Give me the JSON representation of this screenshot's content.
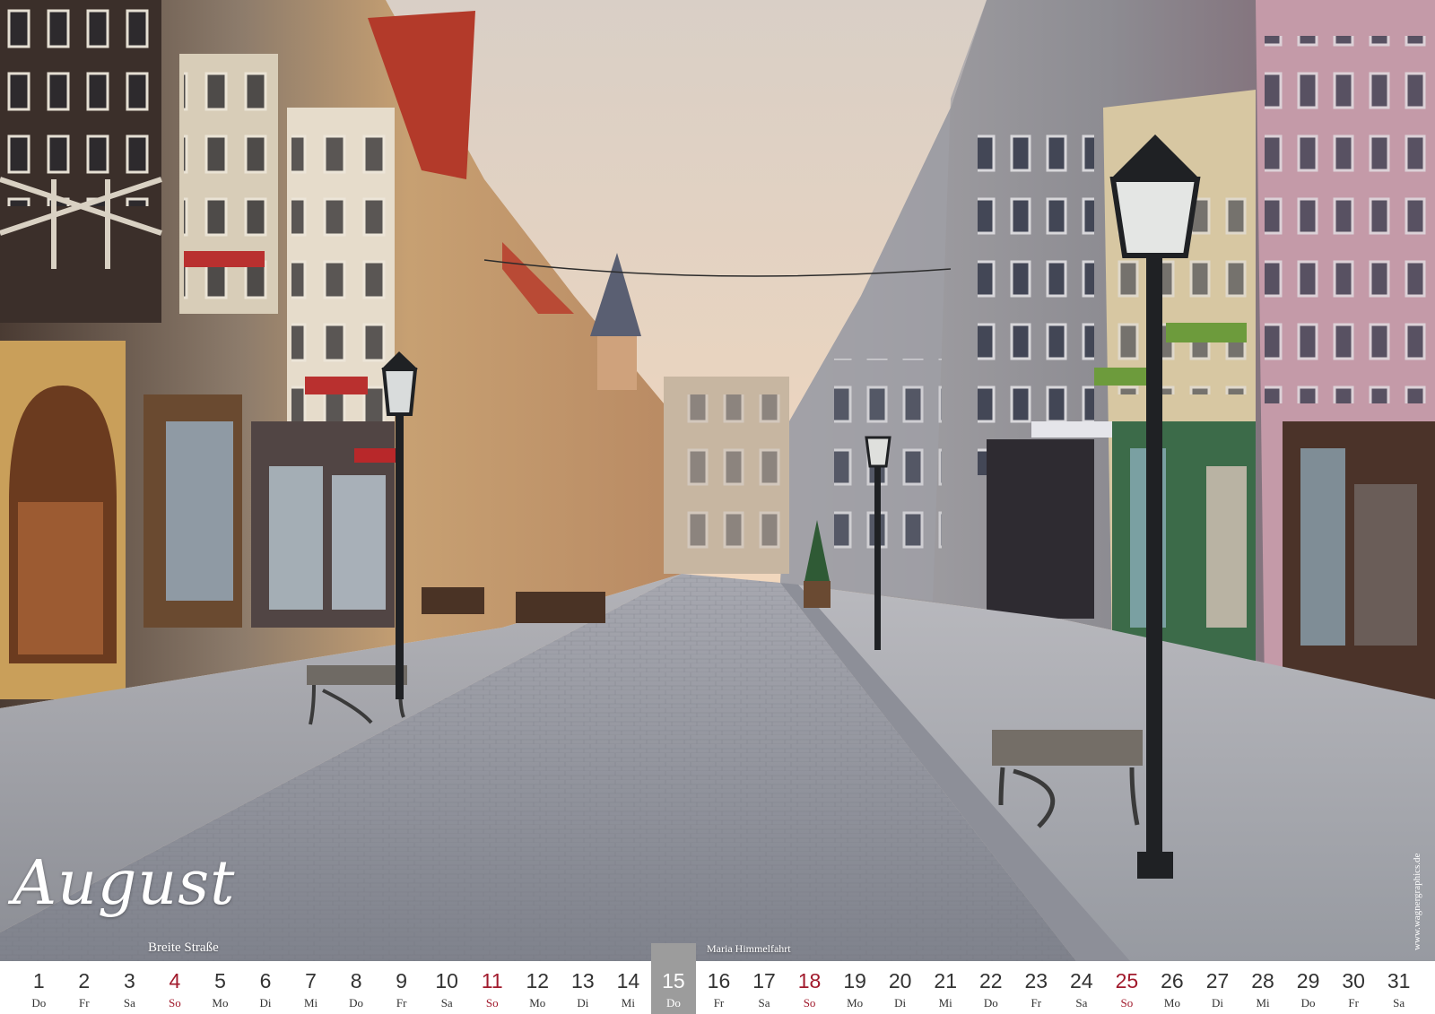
{
  "month": "August",
  "place": "Breite Straße",
  "holiday": "Maria Himmelfahrt",
  "website": "www.wagnergraphics.de",
  "colors": {
    "sunday": "#a11a2c",
    "today_bg": "#9c9c9c",
    "text": "#333333"
  },
  "today": 15,
  "days": [
    {
      "n": "1",
      "wd": "Do"
    },
    {
      "n": "2",
      "wd": "Fr"
    },
    {
      "n": "3",
      "wd": "Sa"
    },
    {
      "n": "4",
      "wd": "So"
    },
    {
      "n": "5",
      "wd": "Mo"
    },
    {
      "n": "6",
      "wd": "Di"
    },
    {
      "n": "7",
      "wd": "Mi"
    },
    {
      "n": "8",
      "wd": "Do"
    },
    {
      "n": "9",
      "wd": "Fr"
    },
    {
      "n": "10",
      "wd": "Sa"
    },
    {
      "n": "11",
      "wd": "So"
    },
    {
      "n": "12",
      "wd": "Mo"
    },
    {
      "n": "13",
      "wd": "Di"
    },
    {
      "n": "14",
      "wd": "Mi"
    },
    {
      "n": "15",
      "wd": "Do"
    },
    {
      "n": "16",
      "wd": "Fr"
    },
    {
      "n": "17",
      "wd": "Sa"
    },
    {
      "n": "18",
      "wd": "So"
    },
    {
      "n": "19",
      "wd": "Mo"
    },
    {
      "n": "20",
      "wd": "Di"
    },
    {
      "n": "21",
      "wd": "Mi"
    },
    {
      "n": "22",
      "wd": "Do"
    },
    {
      "n": "23",
      "wd": "Fr"
    },
    {
      "n": "24",
      "wd": "Sa"
    },
    {
      "n": "25",
      "wd": "So"
    },
    {
      "n": "26",
      "wd": "Mo"
    },
    {
      "n": "27",
      "wd": "Di"
    },
    {
      "n": "28",
      "wd": "Mi"
    },
    {
      "n": "29",
      "wd": "Do"
    },
    {
      "n": "30",
      "wd": "Fr"
    },
    {
      "n": "31",
      "wd": "Sa"
    }
  ]
}
